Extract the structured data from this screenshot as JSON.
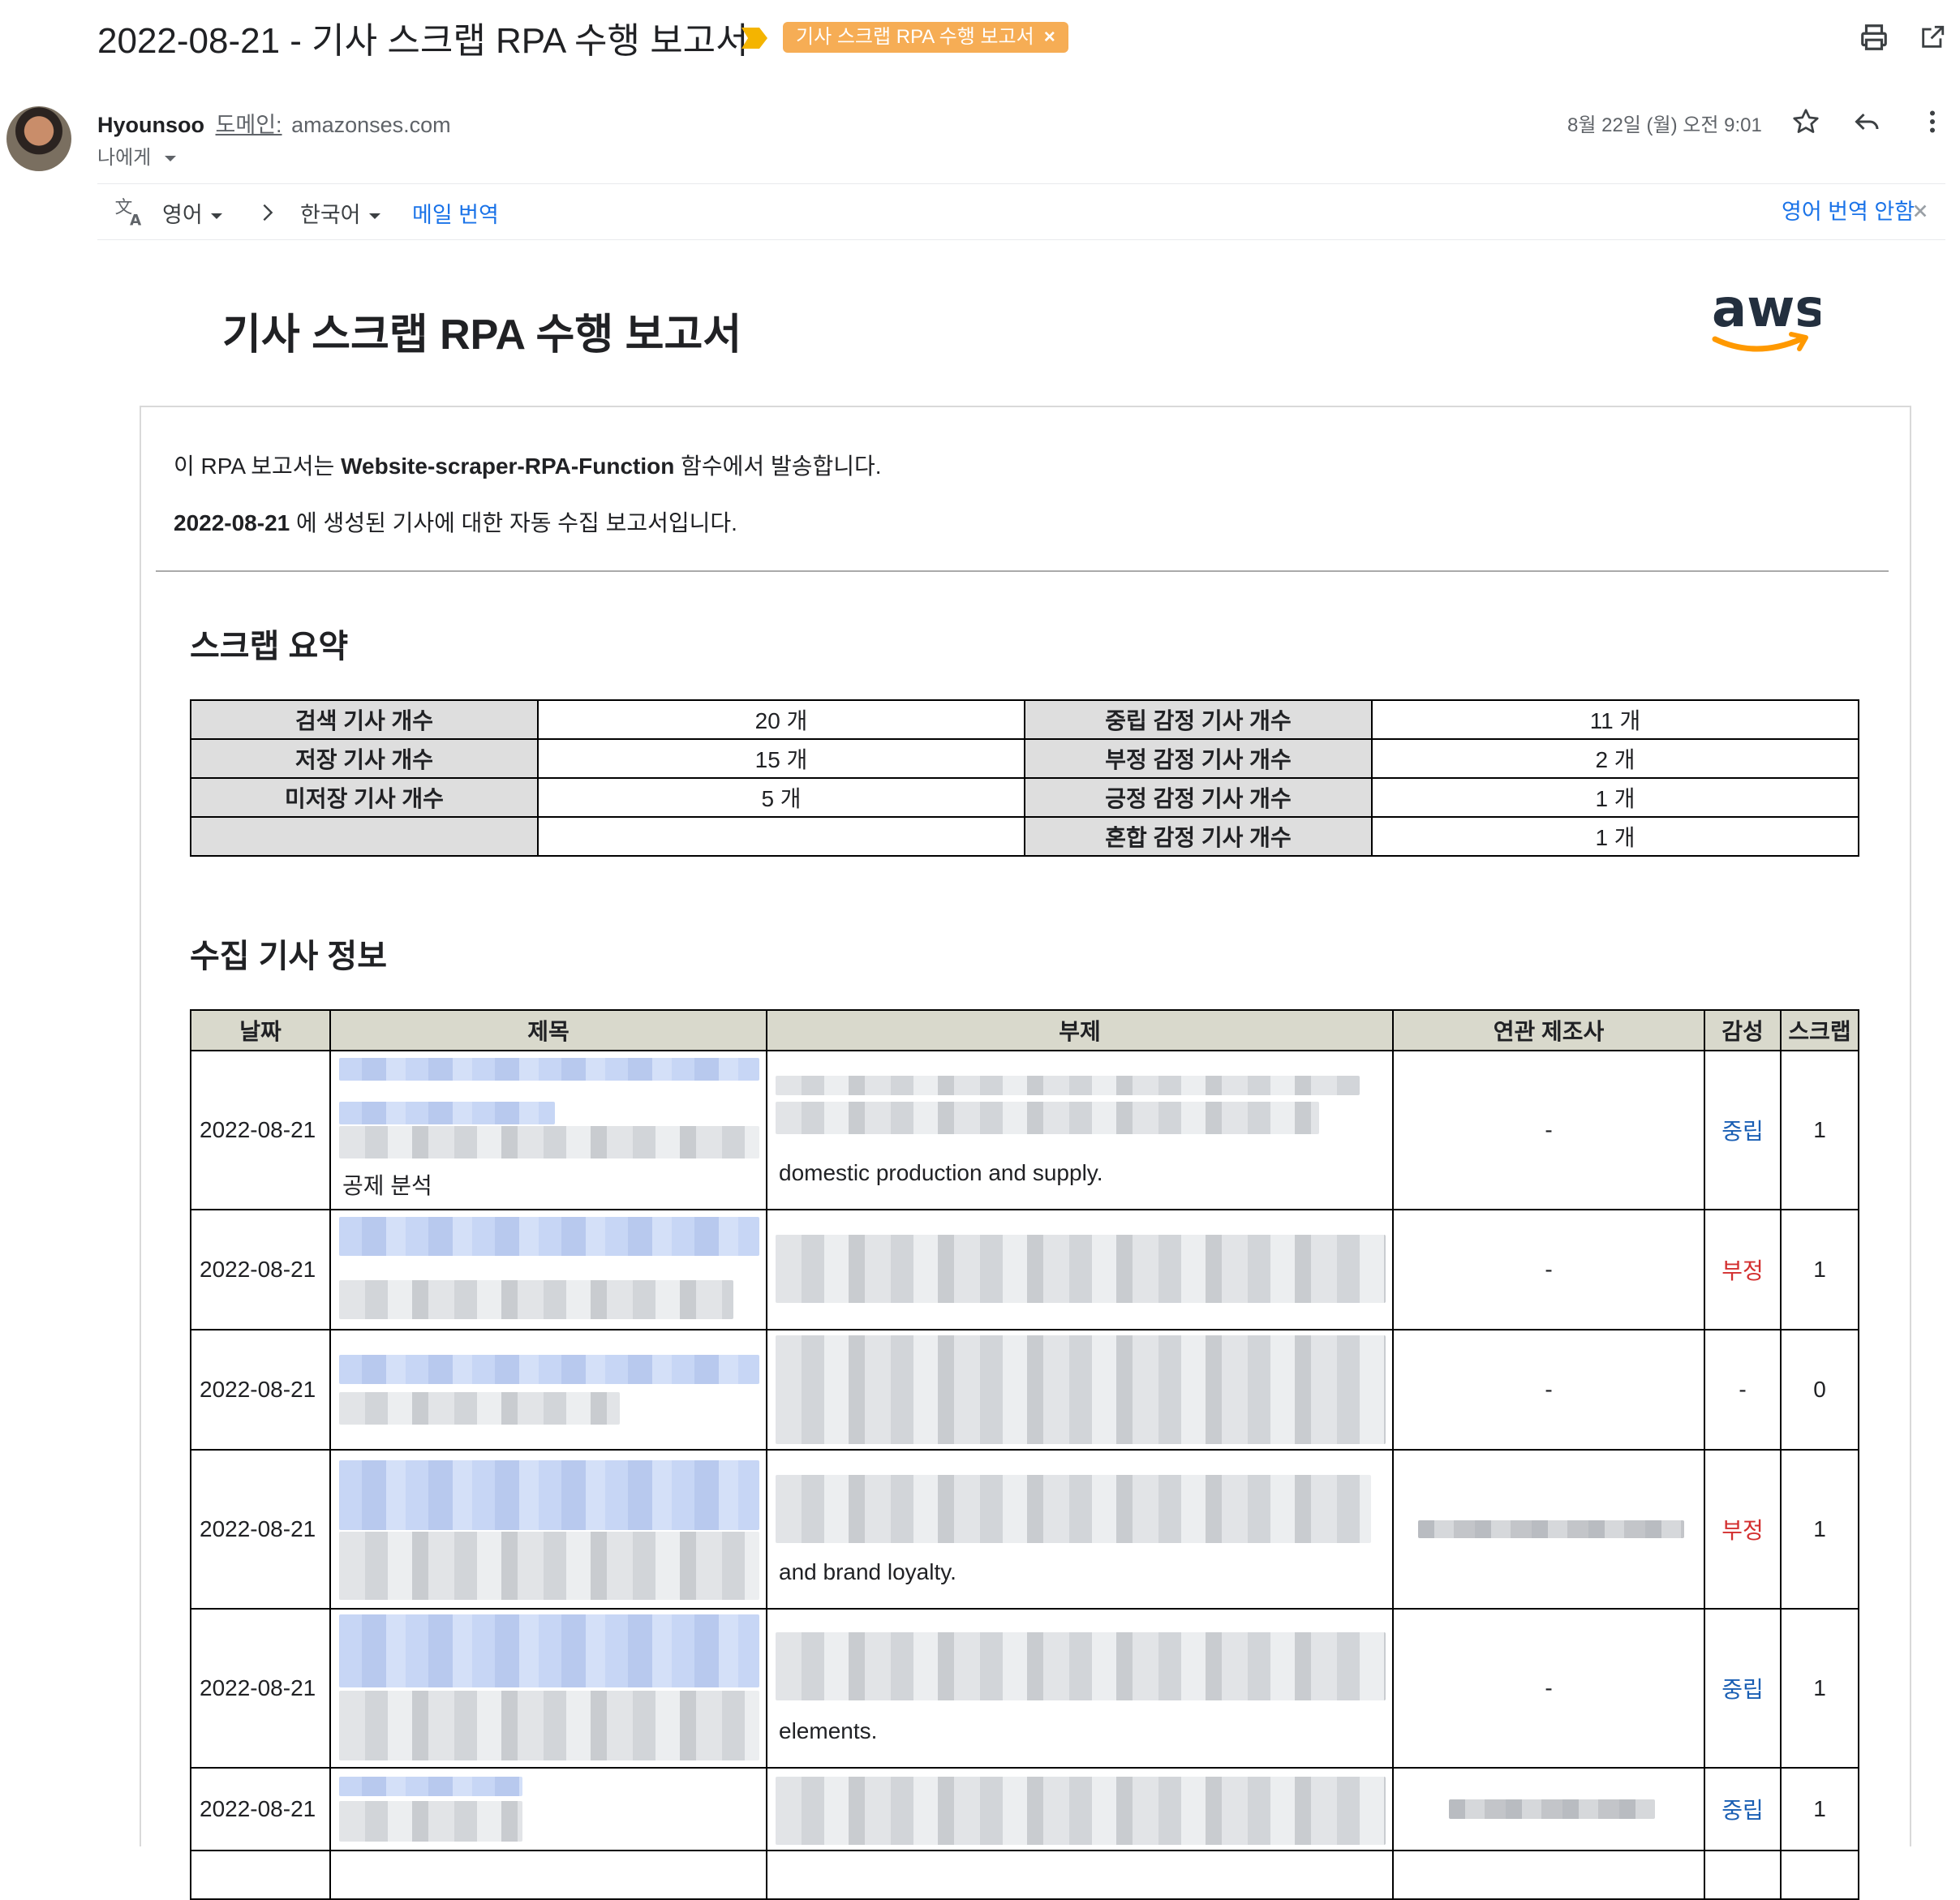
{
  "email": {
    "subject": "2022-08-21 - 기사 스크랩 RPA 수행 보고서",
    "label_chip": "기사 스크랩 RPA 수행 보고서",
    "label_chip_close": "×",
    "sender_name": "Hyounsoo",
    "domain_label": "도메인:",
    "domain_value": "amazonses.com",
    "recipient": "나에게",
    "date": "8월 22일 (월) 오전 9:01"
  },
  "translate_bar": {
    "source_lang": "영어",
    "target_lang": "한국어",
    "translate_link": "메일 번역",
    "no_translate_link": "영어 번역 안함"
  },
  "report": {
    "title": "기사 스크랩 RPA 수행 보고서",
    "logo_text": "aws",
    "intro_prefix": "이 RPA 보고서는 ",
    "intro_function": "Website-scraper-RPA-Function",
    "intro_suffix": " 함수에서 발송합니다.",
    "date_bold": "2022-08-21",
    "date_suffix": " 에 생성된 기사에 대한 자동 수집 보고서입니다.",
    "summary_heading": "스크랩 요약",
    "summary": [
      {
        "k1": "검색 기사 개수",
        "v1": "20 개",
        "k2": "중립 감정 기사 개수",
        "v2": "11 개"
      },
      {
        "k1": "저장 기사 개수",
        "v1": "15 개",
        "k2": "부정 감정 기사 개수",
        "v2": "2 개"
      },
      {
        "k1": "미저장 기사 개수",
        "v1": "5 개",
        "k2": "긍정 감정 기사 개수",
        "v2": "1 개"
      },
      {
        "k1": "",
        "v1": "",
        "k2": "혼합 감정 기사 개수",
        "v2": "1 개"
      }
    ],
    "articles_heading": "수집 기사 정보",
    "columns": [
      "날짜",
      "제목",
      "부제",
      "연관 제조사",
      "감성",
      "스크랩"
    ],
    "rows": [
      {
        "date": "2022-08-21",
        "title_tail": "공제 분석",
        "subtitle_tail": "domestic production and supply.",
        "maker": "-",
        "sentiment": "중립",
        "scrap": "1"
      },
      {
        "date": "2022-08-21",
        "title_tail": "",
        "subtitle_tail": "",
        "maker": "-",
        "sentiment": "부정",
        "scrap": "1"
      },
      {
        "date": "2022-08-21",
        "title_tail": "",
        "subtitle_tail": "",
        "maker": "-",
        "sentiment": "-",
        "scrap": "0"
      },
      {
        "date": "2022-08-21",
        "title_tail": "",
        "subtitle_tail": "and brand loyalty.",
        "maker": "",
        "sentiment": "부정",
        "scrap": "1"
      },
      {
        "date": "2022-08-21",
        "title_tail": "",
        "subtitle_tail": "elements.",
        "maker": "-",
        "sentiment": "중립",
        "scrap": "1"
      },
      {
        "date": "2022-08-21",
        "title_tail": "",
        "subtitle_tail": "",
        "maker": "",
        "sentiment": "중립",
        "scrap": "1"
      }
    ]
  },
  "colors": {
    "label_chip": "#f6ad55",
    "link": "#1a73e8",
    "neutral": "#1a5fb4",
    "negative": "#d32f2f",
    "aws_smile": "#ff9900"
  },
  "icons": [
    "importance-marker-icon",
    "print-icon",
    "open-new-window-icon",
    "star-icon",
    "reply-icon",
    "more-vert-icon",
    "translate-icon",
    "chevron-right-icon",
    "close-icon",
    "aws-smile-icon"
  ]
}
